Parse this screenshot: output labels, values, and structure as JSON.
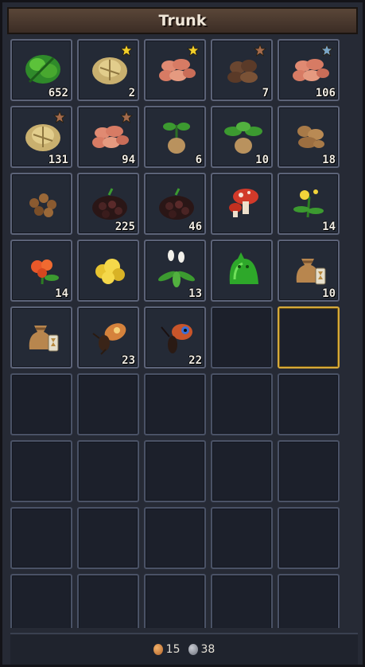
{
  "title": "Trunk",
  "slots": [
    {
      "icon": "green-herb-icon",
      "count": "652",
      "star": ""
    },
    {
      "icon": "cabbage-icon",
      "count": "2",
      "star": "gold"
    },
    {
      "icon": "potato-icon",
      "count": "",
      "star": "gold"
    },
    {
      "icon": "dark-roots-icon",
      "count": "7",
      "star": "bronze"
    },
    {
      "icon": "potato-icon",
      "count": "106",
      "star": "silver"
    },
    {
      "icon": "cabbage-icon",
      "count": "131",
      "star": "bronze"
    },
    {
      "icon": "potato-icon",
      "count": "94",
      "star": "bronze"
    },
    {
      "icon": "mandrake-sprout-icon",
      "count": "6",
      "star": ""
    },
    {
      "icon": "mandrake-leafy-icon",
      "count": "10",
      "star": ""
    },
    {
      "icon": "ginger-root-icon",
      "count": "18",
      "star": ""
    },
    {
      "icon": "hazelnuts-icon",
      "count": "",
      "star": ""
    },
    {
      "icon": "blackberries-icon",
      "count": "225",
      "star": ""
    },
    {
      "icon": "blackberries-icon",
      "count": "46",
      "star": ""
    },
    {
      "icon": "red-mushroom-icon",
      "count": "",
      "star": ""
    },
    {
      "icon": "yellow-flower-icon",
      "count": "14",
      "star": ""
    },
    {
      "icon": "orange-flower-icon",
      "count": "14",
      "star": ""
    },
    {
      "icon": "gold-nuggets-icon",
      "count": "",
      "star": ""
    },
    {
      "icon": "white-flower-plant-icon",
      "count": "13",
      "star": ""
    },
    {
      "icon": "green-slime-icon",
      "count": "",
      "star": ""
    },
    {
      "icon": "seed-bag-icon",
      "count": "10",
      "star": ""
    },
    {
      "icon": "seed-bag-icon",
      "count": "",
      "star": ""
    },
    {
      "icon": "orange-moth-icon",
      "count": "23",
      "star": ""
    },
    {
      "icon": "peacock-butterfly-icon",
      "count": "22",
      "star": ""
    },
    {
      "icon": "",
      "count": "",
      "star": ""
    },
    {
      "icon": "",
      "count": "",
      "star": "",
      "selected": true
    }
  ],
  "footer": {
    "copper_count": "15",
    "silver_count": "38"
  },
  "colors": {
    "slot_border": "#4a5266",
    "selected_border": "#d6a93a",
    "title_bar": "#4b3a2f"
  }
}
